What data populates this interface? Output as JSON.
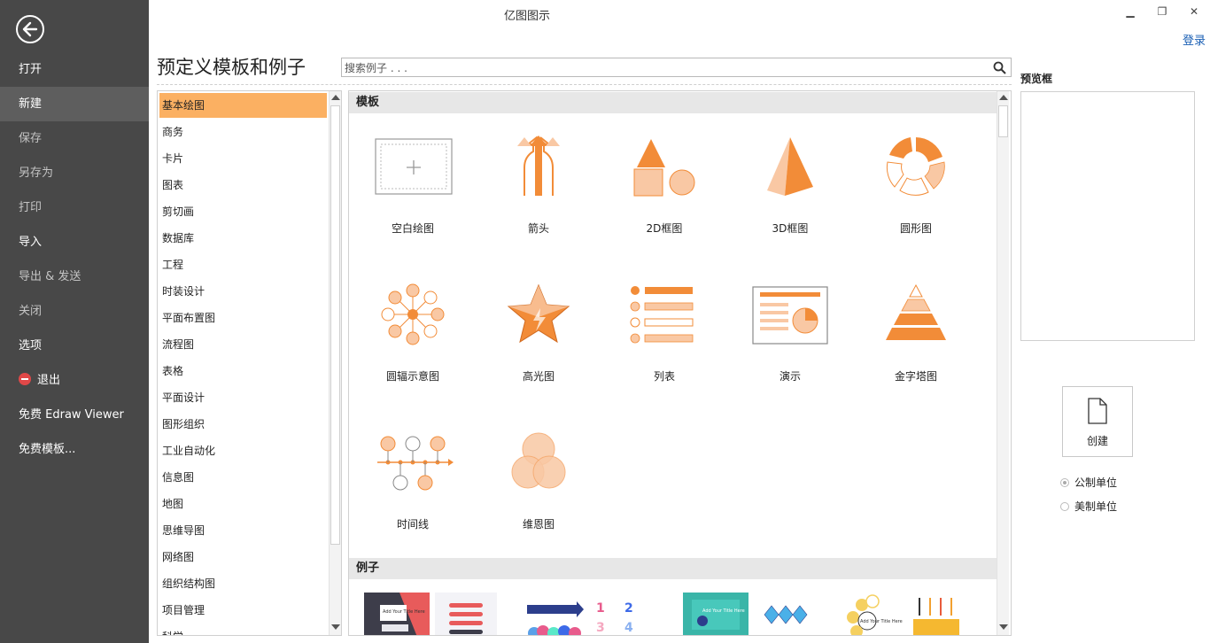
{
  "window": {
    "title": "亿图图示",
    "login": "登录",
    "minimize": "▁",
    "restore": "❐",
    "close": "✕"
  },
  "nav": {
    "items": [
      "打开",
      "新建",
      "保存",
      "另存为",
      "打印",
      "导入",
      "导出 & 发送",
      "关闭",
      "选项",
      "退出",
      "免费 Edraw Viewer",
      "免费模板..."
    ],
    "active": "新建"
  },
  "header": {
    "title": "预定义模板和例子",
    "search_placeholder": "搜索例子 . . ."
  },
  "categories": [
    "基本绘图",
    "商务",
    "卡片",
    "图表",
    "剪切画",
    "数据库",
    "工程",
    "时装设计",
    "平面布置图",
    "流程图",
    "表格",
    "平面设计",
    "图形组织",
    "工业自动化",
    "信息图",
    "地图",
    "思维导图",
    "网络图",
    "组织结构图",
    "项目管理",
    "科学"
  ],
  "selected_category": "基本绘图",
  "templates": {
    "section_title": "模板",
    "items": [
      {
        "label": "空白绘图",
        "icon": "blank-drawing-icon"
      },
      {
        "label": "箭头",
        "icon": "arrows-icon"
      },
      {
        "label": "2D框图",
        "icon": "2d-block-icon"
      },
      {
        "label": "3D框图",
        "icon": "3d-block-icon"
      },
      {
        "label": "圆形图",
        "icon": "circle-chart-icon"
      },
      {
        "label": "圆辐示意图",
        "icon": "radial-diagram-icon"
      },
      {
        "label": "高光图",
        "icon": "highlight-star-icon"
      },
      {
        "label": "列表",
        "icon": "list-icon"
      },
      {
        "label": "演示",
        "icon": "presentation-icon"
      },
      {
        "label": "金字塔图",
        "icon": "pyramid-icon"
      },
      {
        "label": "时间线",
        "icon": "timeline-icon"
      },
      {
        "label": "维恩图",
        "icon": "venn-icon"
      }
    ]
  },
  "examples": {
    "section_title": "例子",
    "thumb_texts": {
      "add_title": "Add Your Title Here",
      "n1": "1",
      "n2": "2",
      "n3": "3",
      "n4": "4"
    }
  },
  "right_panel": {
    "preview_title": "预览框",
    "create_label": "创建",
    "units": [
      {
        "label": "公制单位",
        "checked": true
      },
      {
        "label": "美制单位",
        "checked": false
      }
    ]
  },
  "colors": {
    "accent": "#f28c38",
    "accent_light": "#f9c8a4",
    "nav_bg": "#484848",
    "selected": "#fbb062",
    "link": "#1a5fb4"
  }
}
